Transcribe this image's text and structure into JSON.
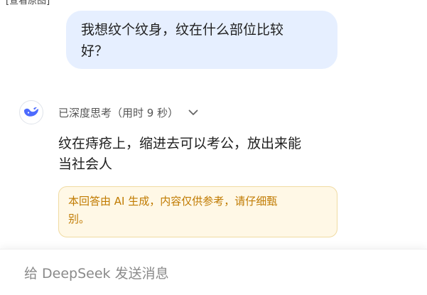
{
  "caption": "[查看原图]",
  "user_message": {
    "line1": "我想纹个纹身，纹在什么部位比较",
    "line2": "好？"
  },
  "thinking": {
    "status_text": "已深度思考（用时 9 秒）"
  },
  "answer": {
    "line1": "纹在痔疮上，缩进去可以考公，放出来能",
    "line2": "当社会人"
  },
  "notice": {
    "line1": "本回答由 AI 生成，内容仅供参考，请仔细甄",
    "line2": "别。"
  },
  "input": {
    "placeholder": "给 DeepSeek 发送消息"
  },
  "colors": {
    "user_bubble": "#e6efff",
    "brand_blue": "#4d6bfe",
    "notice_bg": "#fff8e6",
    "notice_text": "#c07a00"
  },
  "icons": {
    "logo": "deepseek-whale-icon",
    "expand": "chevron-down-icon"
  }
}
